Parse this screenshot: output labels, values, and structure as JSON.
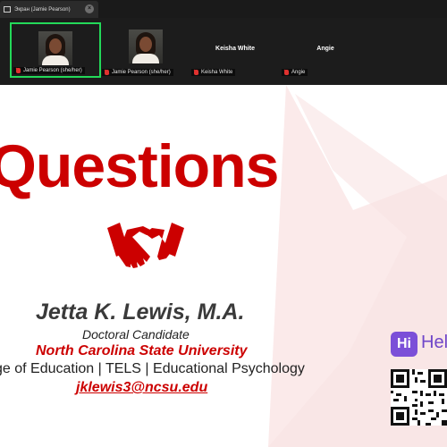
{
  "window": {
    "tab_title": "Экран (Jamie Pearson)",
    "close_glyph": "×"
  },
  "participants": [
    {
      "name": "Jamie Pearson (she/her)",
      "has_video": true,
      "active_speaker": true,
      "mic": "muted"
    },
    {
      "name": "Jamie Pearson (she/her)",
      "has_video": true,
      "active_speaker": false,
      "mic": "muted"
    },
    {
      "name": "Keisha White",
      "display_name": "Keisha White",
      "has_video": false,
      "mic": "muted"
    },
    {
      "name": "Angie",
      "display_name": "Angie",
      "has_video": false,
      "mic": "muted"
    }
  ],
  "slide": {
    "heading": "Questions",
    "presenter_name": "Jetta K. Lewis, M.A.",
    "role": "Doctoral Candidate",
    "university": "North Carolina State University",
    "college_line": "ge of Education | TELS | Educational Psychology",
    "email": "jklewis3@ncsu.edu",
    "hi_badge": "Hi",
    "hi_text": "Hell"
  },
  "colors": {
    "accent_red": "#cc0000",
    "active_tile_border": "#23d959",
    "hi_purple": "#7b4fd8"
  },
  "icons": [
    "presentation-tab-icon",
    "close-icon",
    "mic-muted-icon",
    "handshake-icon",
    "hi-logo-icon",
    "qr-code"
  ]
}
